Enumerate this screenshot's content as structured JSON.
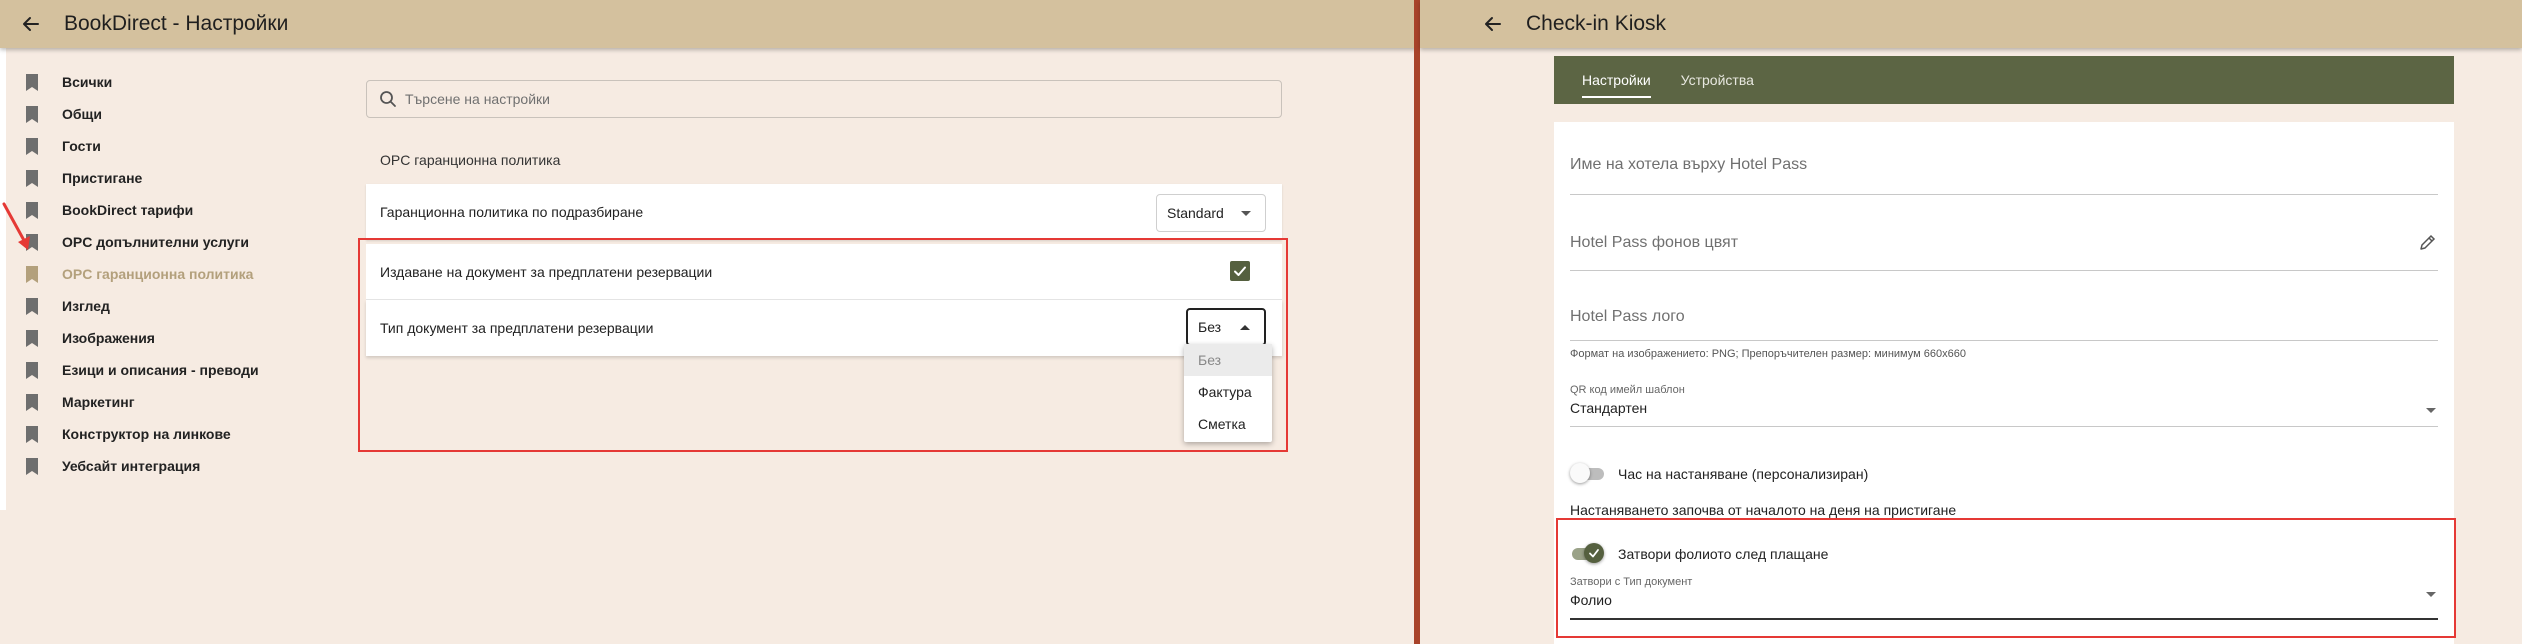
{
  "left": {
    "title": "BookDirect - Настройки",
    "sidebar": {
      "items": [
        {
          "label": "Всички"
        },
        {
          "label": "Общи"
        },
        {
          "label": "Гости"
        },
        {
          "label": "Пристигане"
        },
        {
          "label": "BookDirect тарифи"
        },
        {
          "label": "OPC допълнителни услуги"
        },
        {
          "label": "OPC гаранционна политика",
          "active": true
        },
        {
          "label": "Изглед"
        },
        {
          "label": "Изображения"
        },
        {
          "label": "Езици и описания - преводи"
        },
        {
          "label": "Маркетинг"
        },
        {
          "label": "Конструктор на линкове"
        },
        {
          "label": "Уебсайт интеграция"
        }
      ]
    },
    "search": {
      "placeholder": "Търсене на настройки"
    },
    "section_title": "OPC гаранционна политика",
    "rows": {
      "default_policy": {
        "label": "Гаранционна политика по подразбиране",
        "value": "Standard"
      },
      "issue_doc": {
        "label": "Издаване на документ за предплатени резервации",
        "checked": true
      },
      "doc_type": {
        "label": "Тип документ за предплатени резервации",
        "value": "Без"
      }
    },
    "doc_type_options": [
      "Без",
      "Фактура",
      "Сметка"
    ],
    "colors": {
      "accent": "#55603f",
      "topbar": "#d4c19e",
      "highlight": "#e53935",
      "active_item": "#b3a07c"
    }
  },
  "right": {
    "title": "Check-in Kiosk",
    "tabs": [
      {
        "label": "Настройки",
        "active": true
      },
      {
        "label": "Устройства",
        "active": false
      }
    ],
    "form": {
      "hotel_name_label": "Име на хотела върху Hotel Pass",
      "bg_color_label": "Hotel Pass фонов цвят",
      "logo_label": "Hotel Pass лого",
      "logo_hint": "Формат на изображението: PNG; Препоръчителен размер: минимум 660x660",
      "qr_template_label": "QR код имейл шаблон",
      "qr_template_value": "Стандартен",
      "checkin_time_toggle": {
        "label": "Час на настаняване (персонализиран)",
        "on": false
      },
      "checkin_note": "Настаняването започва от началото на деня на пристигане",
      "close_folio_toggle": {
        "label": "Затвори фолиото след плащане",
        "on": true
      },
      "close_doc_type_label": "Затвори с Тип документ",
      "close_doc_type_value": "Фолио"
    },
    "colors": {
      "tabs_bg": "#5c6544",
      "divider": "#a8432a"
    }
  }
}
